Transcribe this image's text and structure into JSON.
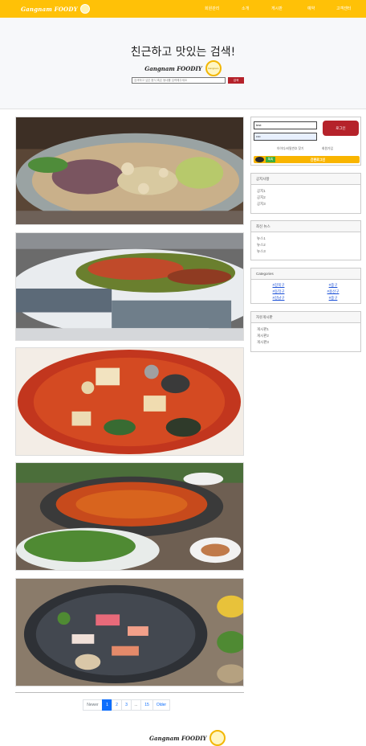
{
  "navbar": {
    "brand": "Gangnam FOODY",
    "items": [
      "회원관리",
      "소개",
      "게시판",
      "예약",
      "고객센터"
    ]
  },
  "hero": {
    "title": "친근하고 맛있는 검색!",
    "logo_text": "Gangnam FOODIY",
    "logo_badge": "Gangnam",
    "search_placeholder": "검색하고 싶은 음식 혹은 동네를 입력해주세요",
    "search_button": "검색"
  },
  "feed": {
    "photos": [
      "boiled-pork-hotpot-photo",
      "raw-fish-with-garnish-photo",
      "spicy-stew-photo",
      "jjigae-grill-photo",
      "sashimi-platter-photo"
    ]
  },
  "pagination": {
    "newer": "Newer",
    "pages": [
      "1",
      "2",
      "3",
      "...",
      "15"
    ],
    "older": "Older",
    "active": "1"
  },
  "footer": {
    "logo_text": "Gangnam FOODIY"
  },
  "login": {
    "id_value": "test",
    "pw_value": "••••",
    "login_button": "로그인",
    "find_account": "아이디/비밀번호 찾기",
    "signup": "회원가입",
    "kakao_badge": "톡톡",
    "kakao_label": "간편로그인"
  },
  "notice": {
    "title": "공지사항",
    "items": [
      "공지1",
      "공지2",
      "공지3"
    ]
  },
  "news": {
    "title": "최신 뉴스",
    "items": [
      "뉴스1",
      "뉴스2",
      "뉴스3"
    ]
  },
  "categories": {
    "title": "Categories",
    "items": [
      "#강북구",
      "#중구",
      "#동작구",
      "#용산구",
      "#강남구",
      "#중구"
    ]
  },
  "free_board": {
    "title": "자유게시판",
    "items": [
      "게시판1",
      "게시판2",
      "게시판3"
    ]
  },
  "colors": {
    "navbar": "#ffc107",
    "accent_red": "#b5222a",
    "link_blue": "#0d6efd"
  }
}
